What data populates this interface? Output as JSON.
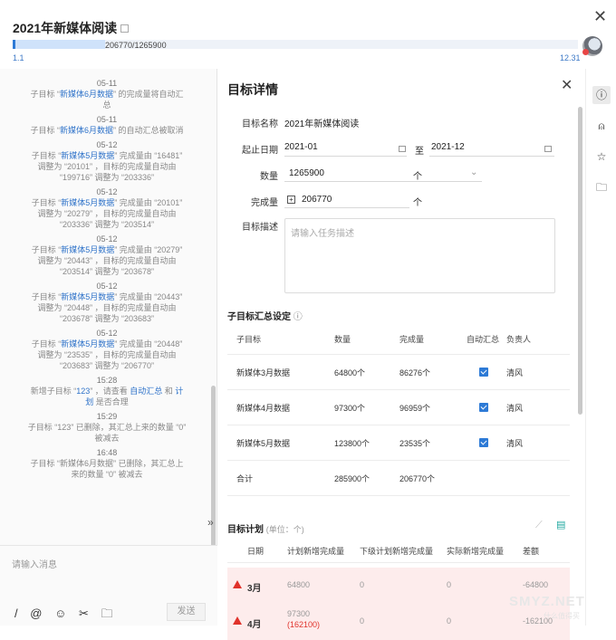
{
  "header": {
    "title": "2021年新媒体阅读",
    "progress_text": "206770/1265900",
    "progress_fraction": 0.163,
    "start_label": "1.1",
    "end_label": "12.31"
  },
  "feed": [
    {
      "time": "05-11",
      "parts": [
        [
          "子目标 “",
          ""
        ],
        [
          "新媒体6月数据",
          "hl"
        ],
        [
          "” 的完成量将自动汇总",
          ""
        ]
      ]
    },
    {
      "time": "05-11",
      "parts": [
        [
          "子目标 “",
          ""
        ],
        [
          "新媒体6月数据",
          "hl"
        ],
        [
          "” 的自动汇总被取消",
          ""
        ]
      ]
    },
    {
      "time": "05-12",
      "parts": [
        [
          "子目标 “",
          ""
        ],
        [
          "新媒体5月数据",
          "hl"
        ],
        [
          "” 完成量由 “16481” 调整为 “20101” ，目标的完成量自动由 “199716” 调整为 “203336”",
          ""
        ]
      ]
    },
    {
      "time": "05-12",
      "parts": [
        [
          "子目标 “",
          ""
        ],
        [
          "新媒体5月数据",
          "hl"
        ],
        [
          "” 完成量由 “20101” 调整为 “20279” ，目标的完成量自动由 “203336” 调整为 “203514”",
          ""
        ]
      ]
    },
    {
      "time": "05-12",
      "parts": [
        [
          "子目标 “",
          ""
        ],
        [
          "新媒体5月数据",
          "hl"
        ],
        [
          "” 完成量由 “20279” 调整为 “20443” ，目标的完成量自动由 “203514” 调整为 “203678”",
          ""
        ]
      ]
    },
    {
      "time": "05-12",
      "parts": [
        [
          "子目标 “",
          ""
        ],
        [
          "新媒体5月数据",
          "hl"
        ],
        [
          "” 完成量由 “20443” 调整为 “20448” ，目标的完成量自动由 “203678” 调整为 “203683”",
          ""
        ]
      ]
    },
    {
      "time": "05-12",
      "parts": [
        [
          "子目标 “",
          ""
        ],
        [
          "新媒体5月数据",
          "hl"
        ],
        [
          "” 完成量由 “20448” 调整为 “23535” ，目标的完成量自动由 “203683” 调整为 “206770”",
          ""
        ]
      ]
    },
    {
      "time": "15:28",
      "parts": [
        [
          "新增子目标 “",
          ""
        ],
        [
          "123",
          "hl"
        ],
        [
          "” ，请查看 ",
          ""
        ],
        [
          "自动汇总",
          "hl"
        ],
        [
          " 和 ",
          ""
        ],
        [
          "计划",
          "hl"
        ],
        [
          " 是否合理",
          ""
        ]
      ]
    },
    {
      "time": "15:29",
      "parts": [
        [
          "子目标 “123” 已删除，其汇总上来的数量 “0” 被减去",
          ""
        ]
      ]
    },
    {
      "time": "16:48",
      "parts": [
        [
          "子目标 “新媒体6月数据” 已删除，其汇总上来的数量 “0” 被减去",
          ""
        ]
      ]
    }
  ],
  "compose": {
    "placeholder": "请输入消息",
    "send_label": "发送",
    "tools": [
      "/",
      "@",
      "☺",
      "✂",
      "🗀"
    ]
  },
  "detail": {
    "title": "目标详情",
    "fields": {
      "name_label": "目标名称",
      "name_value": "2021年新媒体阅读",
      "date_label": "起止日期",
      "date_start": "2021-01",
      "date_sep": "至",
      "date_end": "2021-12",
      "qty_label": "数量",
      "qty_value": "1265900",
      "qty_unit": "个",
      "done_label": "完成量",
      "done_value": "206770",
      "done_unit": "个",
      "desc_label": "目标描述",
      "desc_placeholder": "请输入任务描述"
    },
    "subtargets": {
      "heading": "子目标汇总设定",
      "headers": [
        "子目标",
        "数量",
        "完成量",
        "自动汇总",
        "负责人"
      ],
      "rows": [
        {
          "name": "新媒体3月数据",
          "qty": "64800个",
          "done": "86276个",
          "auto": true,
          "owner": "清风"
        },
        {
          "name": "新媒体4月数据",
          "qty": "97300个",
          "done": "96959个",
          "auto": true,
          "owner": "清风"
        },
        {
          "name": "新媒体5月数据",
          "qty": "123800个",
          "done": "23535个",
          "auto": true,
          "owner": "清风"
        }
      ],
      "total": {
        "name": "合计",
        "qty": "285900个",
        "done": "206770个"
      }
    },
    "plan": {
      "heading": "目标计划",
      "unit_note": "(单位：个)",
      "headers": [
        "日期",
        "计划新增完成量",
        "下级计划新增完成量",
        "实际新增完成量",
        "差额"
      ],
      "rows": [
        {
          "date": "3月",
          "plan": "64800",
          "sub": "0",
          "actual": "0",
          "diff": "-64800"
        },
        {
          "date": "4月",
          "plan": "97300",
          "plan2": "(162100)",
          "sub": "0",
          "actual": "0",
          "diff": "-162100"
        }
      ]
    }
  },
  "rail": {
    "icons": [
      "info-icon",
      "person-icon",
      "star-icon",
      "folder-icon"
    ]
  },
  "watermark": {
    "main": "SMYZ.NET",
    "sub": "什么值得买"
  }
}
